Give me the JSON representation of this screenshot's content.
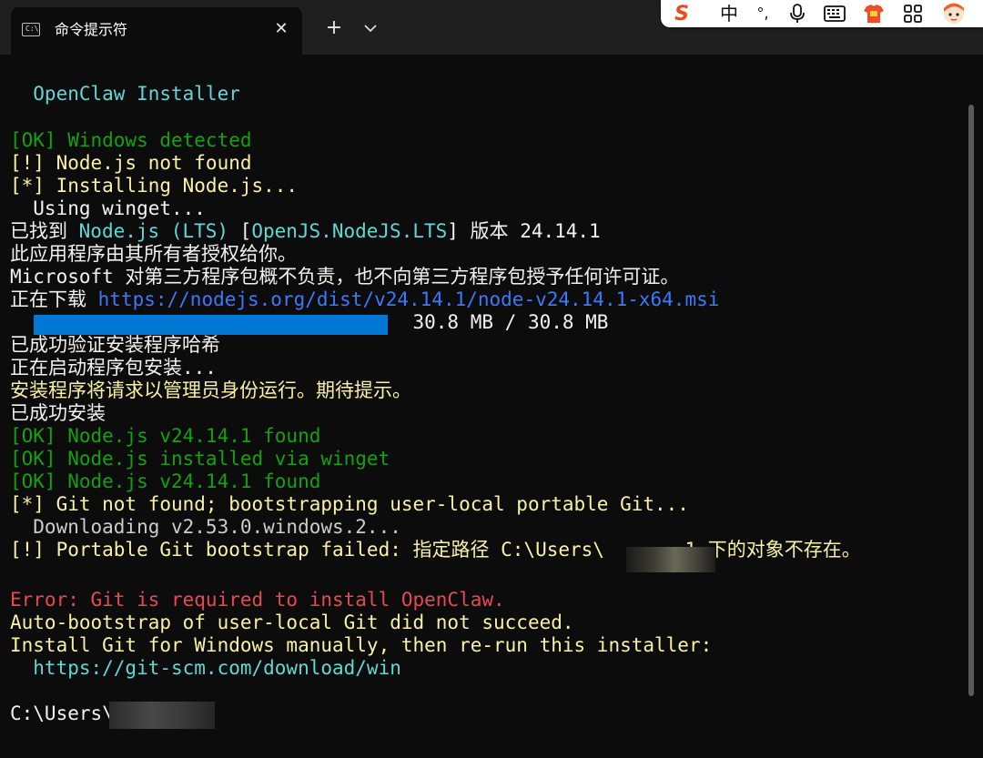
{
  "window": {
    "tab_title": "命令提示符",
    "tab_icon_glyph": "C:\\",
    "close_glyph": "✕",
    "new_tab_glyph": "+"
  },
  "ime_toolbar": {
    "logo_glyph": "S",
    "lang": "中",
    "punct": "°,",
    "icons": [
      "sogou-logo-icon",
      "microphone-icon",
      "keyboard-icon",
      "skin-shirt-icon",
      "toolbox-grid-icon",
      "mascot-avatar-icon"
    ]
  },
  "terminal": {
    "lines": [
      {
        "text": "  OpenClaw Installer",
        "color": "cyan"
      },
      {
        "text": "[OK] Windows detected",
        "color": "green"
      },
      {
        "text": "[!] Node.js not found",
        "color": "yellow"
      },
      {
        "text": "[*] Installing Node.js...",
        "color": "yellow"
      },
      {
        "text": "  Using winget...",
        "color": "white"
      },
      {
        "segments": [
          {
            "text": "已找到 ",
            "color": "white"
          },
          {
            "text": "Node.js (LTS)",
            "color": "cyan"
          },
          {
            "text": " [",
            "color": "white"
          },
          {
            "text": "OpenJS.NodeJS.LTS",
            "color": "cyan"
          },
          {
            "text": "] 版本 24.14.1",
            "color": "white"
          }
        ]
      },
      {
        "text": "此应用程序由其所有者授权给你。",
        "color": "white"
      },
      {
        "text": "Microsoft 对第三方程序包概不负责，也不向第三方程序包授予任何许可证。",
        "color": "white"
      },
      {
        "segments": [
          {
            "text": "正在下载 ",
            "color": "white"
          },
          {
            "text": "https://nodejs.org/dist/v24.14.1/node-v24.14.1-x64.msi",
            "color": "link"
          }
        ]
      },
      {
        "text": "                                   30.8 MB / 30.8 MB",
        "color": "white"
      },
      {
        "text": "已成功验证安装程序哈希",
        "color": "white"
      },
      {
        "text": "正在启动程序包安装...",
        "color": "white"
      },
      {
        "text": "安装程序将请求以管理员身份运行。期待提示。",
        "color": "yellow"
      },
      {
        "text": "已成功安装",
        "color": "white"
      },
      {
        "text": "[OK] Node.js v24.14.1 found",
        "color": "green"
      },
      {
        "text": "[OK] Node.js installed via winget",
        "color": "green"
      },
      {
        "text": "[OK] Node.js v24.14.1 found",
        "color": "green"
      },
      {
        "text": "[*] Git not found; bootstrapping user-local portable Git...",
        "color": "yellow"
      },
      {
        "text": "  Downloading v2.53.0.windows.2...",
        "color": "grey"
      },
      {
        "text": "[!] Portable Git bootstrap failed: 指定路径 C:\\Users\\       1 下的对象不存在。",
        "color": "yellow"
      },
      {
        "text": "",
        "color": "white"
      },
      {
        "text": "Error: Git is required to install OpenClaw.",
        "color": "red"
      },
      {
        "text": "Auto-bootstrap of user-local Git did not succeed.",
        "color": "yellow"
      },
      {
        "text": "Install Git for Windows manually, then re-run this installer:",
        "color": "yellow"
      },
      {
        "text": "  https://git-scm.com/download/win",
        "color": "cyan"
      },
      {
        "text": "",
        "color": "white"
      },
      {
        "text": "C:\\Users\\",
        "color": "white"
      }
    ],
    "progress": {
      "fraction": 1.0
    }
  },
  "colors": {
    "background": "#0c0c0c",
    "titlebar": "#1f1f1f",
    "cyan": "#61d6d6",
    "green": "#13a10e",
    "yellow": "#f9f1a5",
    "white": "#f2f2f2",
    "red": "#e74856",
    "link": "#3b78ff",
    "grey": "#cccccc",
    "progress": "#0078d4"
  }
}
